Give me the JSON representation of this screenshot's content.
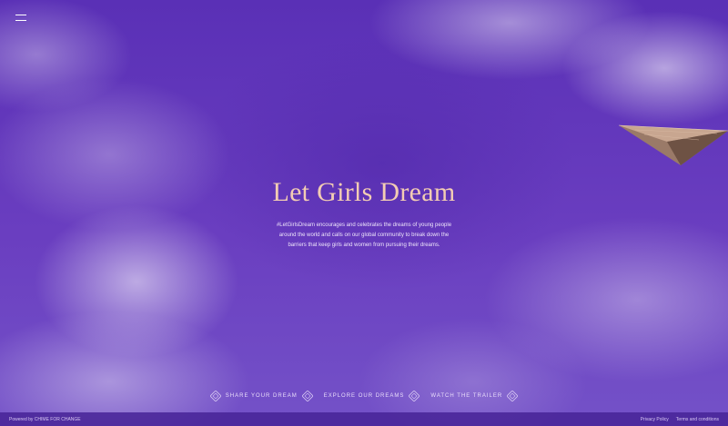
{
  "hero": {
    "title": "Let Girls Dream",
    "description": "#LetGirlsDream encourages and celebrates the dreams of young people around the world and calls on our global community to break down the barriers that keep girls and women from pursuing their dreams."
  },
  "actions": [
    {
      "label": "SHARE YOUR DREAM"
    },
    {
      "label": "EXPLORE OUR DREAMS"
    },
    {
      "label": "WATCH THE TRAILER"
    }
  ],
  "footer": {
    "powered": "Powered by CHIME FOR CHANGE",
    "privacy": "Privacy Policy",
    "terms": "Terms and conditions"
  },
  "colors": {
    "background": "#5a2fb8",
    "title": "#f3cdb3"
  },
  "icons": {
    "menu": "hamburger-icon",
    "plane": "paper-plane-icon",
    "ornament": "diamond-ornament-icon"
  }
}
